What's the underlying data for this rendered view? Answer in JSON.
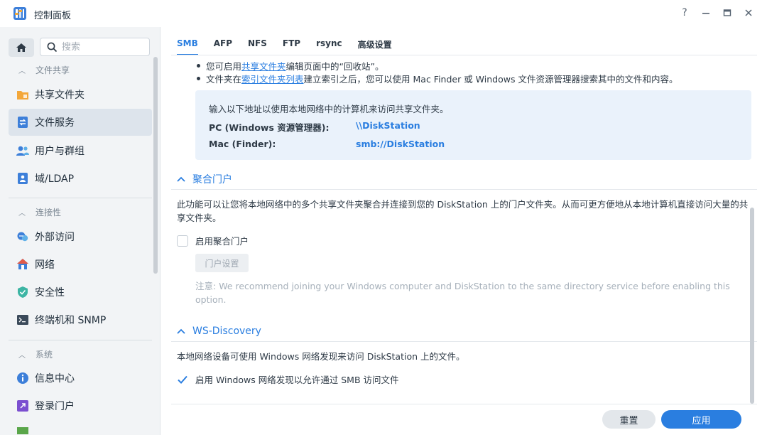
{
  "window": {
    "title": "控制面板",
    "controls": [
      "help-icon",
      "minimize-icon",
      "maximize-icon",
      "close-icon"
    ]
  },
  "sidebar": {
    "search_placeholder": "搜索",
    "sections": [
      {
        "title": "文件共享",
        "items": [
          {
            "label": "共享文件夹",
            "icon": "shared-folder-icon",
            "active": false
          },
          {
            "label": "文件服务",
            "icon": "file-services-icon",
            "active": true
          },
          {
            "label": "用户与群组",
            "icon": "users-group-icon",
            "active": false
          },
          {
            "label": "域/LDAP",
            "icon": "domain-ldap-icon",
            "active": false
          }
        ]
      },
      {
        "title": "连接性",
        "items": [
          {
            "label": "外部访问",
            "icon": "external-access-icon",
            "active": false
          },
          {
            "label": "网络",
            "icon": "network-icon",
            "active": false
          },
          {
            "label": "安全性",
            "icon": "security-shield-icon",
            "active": false
          },
          {
            "label": "终端机和 SNMP",
            "icon": "terminal-icon",
            "active": false
          }
        ]
      },
      {
        "title": "系统",
        "items": [
          {
            "label": "信息中心",
            "icon": "info-center-icon",
            "active": false
          },
          {
            "label": "登录门户",
            "icon": "login-portal-icon",
            "active": false
          }
        ]
      }
    ]
  },
  "tabs": [
    {
      "label": "SMB",
      "active": true
    },
    {
      "label": "AFP",
      "active": false
    },
    {
      "label": "NFS",
      "active": false
    },
    {
      "label": "FTP",
      "active": false
    },
    {
      "label": "rsync",
      "active": false
    },
    {
      "label": "高级设置",
      "active": false
    }
  ],
  "bullets": [
    {
      "before": "您可启用 ",
      "link": "共享文件夹",
      "after": " 编辑页面中的“回收站”。"
    },
    {
      "before": "文件夹在 ",
      "link": "索引文件夹列表",
      "after": "建立索引之后，您可以使用 Mac Finder 或 Windows 文件资源管理器搜索其中的文件和内容。"
    }
  ],
  "info_box": {
    "text": "输入以下地址以使用本地网络中的计算机来访问共享文件夹。",
    "pc_label": "PC (Windows 资源管理器):",
    "pc_value": "\\\\DiskStation",
    "mac_label": "Mac (Finder):",
    "mac_value": "smb://DiskStation"
  },
  "aggregation": {
    "title": "聚合门户",
    "description": "此功能可以让您将本地网络中的多个共享文件夹聚合并连接到您的 DiskStation 上的门户文件夹。从而可更方便地从本地计算机直接访问大量的共享文件夹。",
    "checkbox_label": "启用聚合门户",
    "checked": false,
    "settings_button": "门户设置",
    "note_prefix": "注意:",
    "note": "We recommend joining your Windows computer and DiskStation to the same directory service before enabling this option."
  },
  "ws_discovery": {
    "title": "WS-Discovery",
    "description": "本地网络设备可使用 Windows 网络发现来访问 DiskStation 上的文件。",
    "checkbox_label": "启用 Windows 网络发现以允许通过 SMB 访问文件",
    "checked": true
  },
  "footer": {
    "reset_label": "重置",
    "apply_label": "应用"
  },
  "colors": {
    "accent": "#2a7ee0",
    "info_bg": "#eaf2fb",
    "sidebar_bg": "#f2f4f6"
  }
}
